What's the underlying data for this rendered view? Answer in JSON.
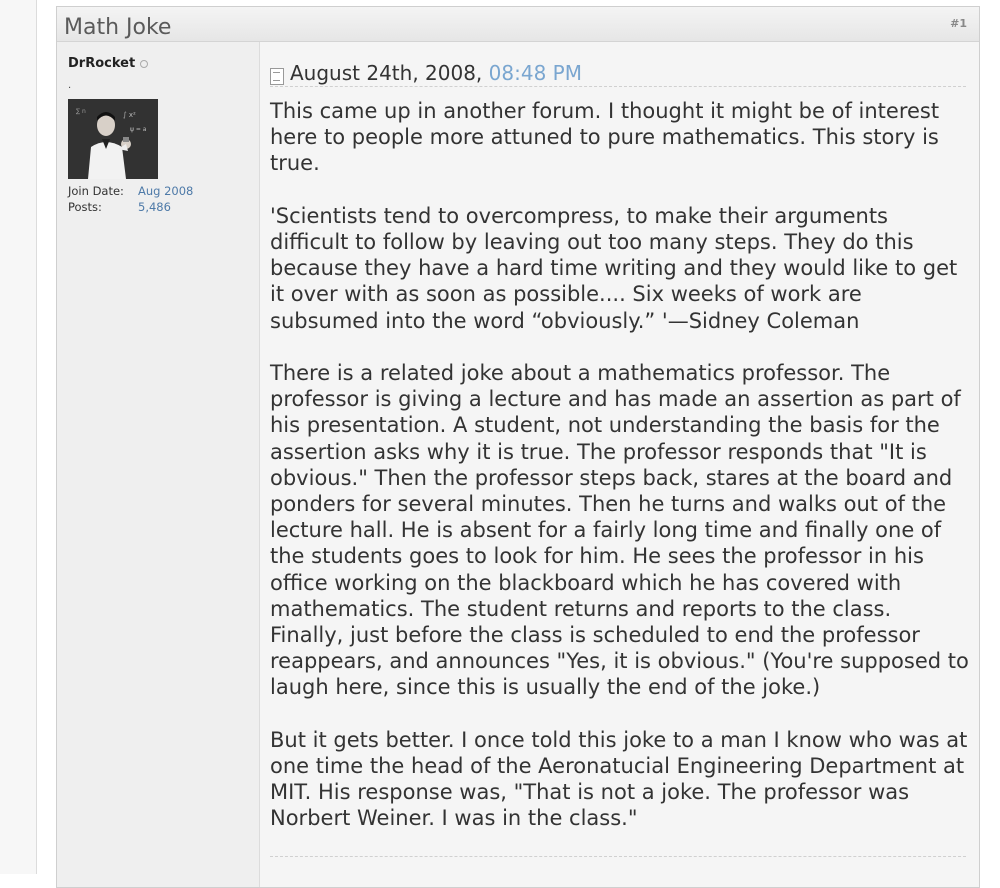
{
  "post": {
    "title": "Math Joke",
    "number": "#1",
    "author": {
      "username": "DrRocket",
      "title_line": ".",
      "join_date_label": "Join Date:",
      "join_date": "Aug 2008",
      "posts_label": "Posts:",
      "posts": "5,486"
    },
    "date": "August 24th, 2008,",
    "time": "08:48 PM",
    "paragraphs": [
      "This came up in another forum. I thought it might be of interest here to people more attuned to pure mathematics. This story is true.",
      "'Scientists tend to overcompress, to make their arguments difficult to follow by leaving out too many steps. They do this because they have a hard time writing and they would like to get it over with as soon as possible.... Six weeks of work are subsumed into the word “obviously.” '—Sidney Coleman",
      "There is a related joke about a mathematics professor. The professor is giving a lecture and has made an assertion as part of his presentation. A student, not understanding the basis for the assertion asks why it is true. The professor responds that \"It is obvious.\" Then the professor steps back, stares at the board and ponders for several minutes. Then he turns and walks out of the lecture hall. He is absent for a fairly long time and finally one of the students goes to look for him. He sees the professor in his office working on the blackboard which he has covered with mathematics. The student returns and reports to the class. Finally, just before the class is scheduled to end the professor reappears, and announces \"Yes, it is obvious.\" (You're supposed to laugh here, since this is usually the end of the joke.)",
      "But it gets better. I once told this joke to a man I know who was at one time the head of the Aeronatucial Engineering Department at MIT. His response was, \"That is not a joke. The professor was Norbert Weiner. I was in the class.\""
    ]
  }
}
